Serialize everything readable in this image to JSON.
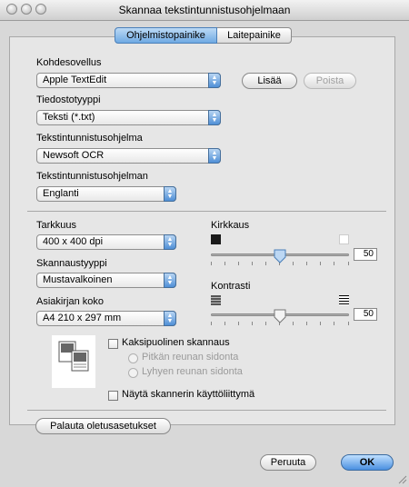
{
  "window": {
    "title": "Skannaa tekstintunnistusohjelmaan"
  },
  "tabs": [
    {
      "label": "Ohjelmistopainike",
      "active": true
    },
    {
      "label": "Laitepainike",
      "active": false
    }
  ],
  "app": {
    "target_label": "Kohdesovellus",
    "target_value": "Apple TextEdit",
    "add_label": "Lisää",
    "remove_label": "Poista",
    "filetype_label": "Tiedostotyyppi",
    "filetype_value": "Teksti (*.txt)",
    "ocr_label": "Tekstintunnistusohjelma",
    "ocr_value": "Newsoft OCR",
    "lang_label": "Tekstintunnistusohjelman",
    "lang_value": "Englanti"
  },
  "scan": {
    "resolution_label": "Tarkkuus",
    "resolution_value": "400 x 400 dpi",
    "scantype_label": "Skannaustyyppi",
    "scantype_value": "Mustavalkoinen",
    "docsize_label": "Asiakirjan koko",
    "docsize_value": "A4  210 x 297 mm",
    "brightness_label": "Kirkkaus",
    "brightness_value": "50",
    "contrast_label": "Kontrasti",
    "contrast_value": "50",
    "duplex_label": "Kaksipuolinen skannaus",
    "long_edge_label": "Pitkän reunan sidonta",
    "short_edge_label": "Lyhyen reunan sidonta",
    "show_ui_label": "Näytä skannerin käyttöliittymä"
  },
  "footer": {
    "restore_label": "Palauta oletusasetukset",
    "cancel_label": "Peruuta",
    "ok_label": "OK"
  },
  "colors": {
    "accent": "#4e8fd6"
  }
}
